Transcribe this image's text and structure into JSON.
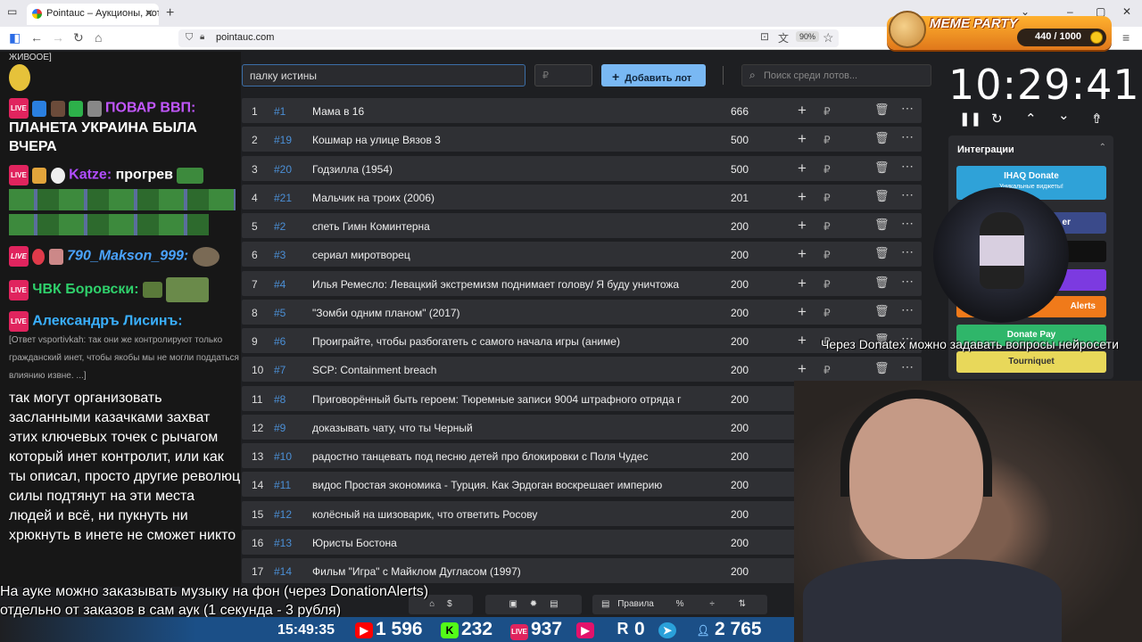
{
  "browser": {
    "tab_title": "Pointauc – Аукционы, лотереи",
    "url": "pointauc.com",
    "zoom": "90%"
  },
  "meme_party": {
    "title": "MEME PARTY",
    "points": "440 / 1000"
  },
  "chat": {
    "top_line": "ЖИВООЕ]",
    "messages": [
      {
        "user": "ПОВАР ВВП:",
        "text": "ПЛАНЕТА УКРАИНА БЫЛА ВЧЕРА",
        "color": "#c257ff"
      },
      {
        "user": "Katze:",
        "text": "прогрев",
        "color": "#b04dff"
      },
      {
        "user": "790_Makson_999:",
        "text": "",
        "color": "#4aa3ff"
      },
      {
        "user": "ЧВК Боровски:",
        "text": "",
        "color": "#2fd06b"
      },
      {
        "user": "Александръ Лисинъ:",
        "text": "",
        "color": "#3ab0ff"
      }
    ],
    "reply": "[Ответ vsportivkah: так они же контролируют только гражданский инет, чтобы якобы мы не могли поддаться влиянию извне. ...]",
    "long_message": "так могут организовать засланными казачками захват этих ключевых точек с рычагом который инет контролит, или как ты описал, просто другие революц силы подтянут на эти места людей и всё, ни пукнуть ни хрюкнуть в инете не сможет никто"
  },
  "toolbar": {
    "lot_input_value": "палку истины",
    "sum_placeholder": "₽",
    "add_button": "Добавить лот",
    "search_placeholder": "Поиск среди лотов..."
  },
  "lots": [
    {
      "n": "1",
      "id": "#1",
      "name": "Мама в 16",
      "amount": "666"
    },
    {
      "n": "2",
      "id": "#19",
      "name": "Кошмар на улице Вязов 3",
      "amount": "500"
    },
    {
      "n": "3",
      "id": "#20",
      "name": "Годзилла (1954)",
      "amount": "500"
    },
    {
      "n": "4",
      "id": "#21",
      "name": "Мальчик на троих (2006)",
      "amount": "201"
    },
    {
      "n": "5",
      "id": "#2",
      "name": "спеть Гимн Коминтерна",
      "amount": "200"
    },
    {
      "n": "6",
      "id": "#3",
      "name": "сериал миротворец",
      "amount": "200"
    },
    {
      "n": "7",
      "id": "#4",
      "name": "Илья Ремесло: Левацкий экстремизм поднимает голову/ Я буду уничтожа",
      "amount": "200"
    },
    {
      "n": "8",
      "id": "#5",
      "name": "\"Зомби одним планом\" (2017)",
      "amount": "200"
    },
    {
      "n": "9",
      "id": "#6",
      "name": "Проиграйте, чтобы разбогатеть с самого начала игры (аниме)",
      "amount": "200"
    },
    {
      "n": "10",
      "id": "#7",
      "name": "SCP: Containment breach",
      "amount": "200"
    },
    {
      "n": "11",
      "id": "#8",
      "name": "Приговорённый быть героем: Тюремные записи 9004 штрафного отряда г",
      "amount": "200"
    },
    {
      "n": "12",
      "id": "#9",
      "name": "доказывать чату, что ты Черный",
      "amount": "200"
    },
    {
      "n": "13",
      "id": "#10",
      "name": "радостно танцевать под песню детей про блокировки с Поля Чудес",
      "amount": "200"
    },
    {
      "n": "14",
      "id": "#11",
      "name": "видос Простая экономика - Турция. Как Эрдоган воскрешает империю",
      "amount": "200"
    },
    {
      "n": "15",
      "id": "#12",
      "name": "колёсный на шизоварик, что ответить Росову",
      "amount": "200"
    },
    {
      "n": "16",
      "id": "#13",
      "name": "Юристы Бостона",
      "amount": "200"
    },
    {
      "n": "17",
      "id": "#14",
      "name": "Фильм \"Игра\" с Майклом Дугласом (1997)",
      "amount": "200"
    }
  ],
  "currency": "₽",
  "timer": "10:29:41",
  "integrations": {
    "header": "Интеграции",
    "ihaq": "IHAQ Donate",
    "ihaq_sub": "Уникальные виджеты!",
    "partial_er": "er",
    "alerts": "Alerts",
    "donate_pay": "Donate Pay",
    "tourniquet": "Tourniquet"
  },
  "overlay": {
    "donatex": "Через Donatex можно задавать вопросы нейросети",
    "music_line1": "На ауке можно заказывать музыку на фон (через DonationAlerts)",
    "music_line2": "отдельно от заказов в сам аук (1 секунда - 3 рубля)"
  },
  "bottom_tools": {
    "rules": "Правила",
    "percent": "%"
  },
  "stream_stats": {
    "time": "15:49:35",
    "youtube": "1 596",
    "kick": "232",
    "vklive": "937",
    "rutube": "0",
    "telegram": "",
    "viewers": "2 765"
  }
}
